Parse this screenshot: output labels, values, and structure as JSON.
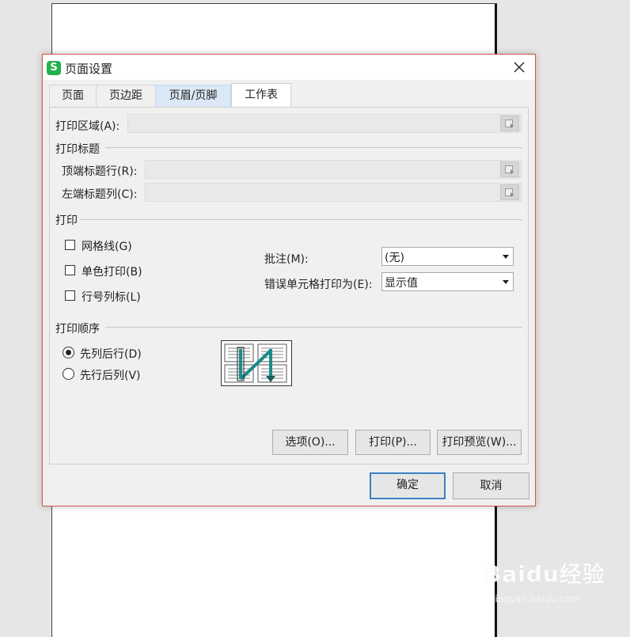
{
  "dialog": {
    "title": "页面设置",
    "app_icon_letter": "S"
  },
  "tabs": [
    {
      "label": "页面"
    },
    {
      "label": "页边距"
    },
    {
      "label": "页眉/页脚"
    },
    {
      "label": "工作表"
    }
  ],
  "print_area": {
    "label": "打印区域(A):",
    "value": ""
  },
  "print_titles": {
    "heading": "打印标题",
    "top_rows_label": "顶端标题行(R):",
    "left_cols_label": "左端标题列(C):"
  },
  "print": {
    "heading": "打印",
    "gridlines": {
      "label": "网格线(G)",
      "checked": false
    },
    "mono": {
      "label": "单色打印(B)",
      "checked": false
    },
    "row_col_headers": {
      "label": "行号列标(L)",
      "checked": false
    },
    "comments_label": "批注(M):",
    "comments_value": "(无)",
    "errors_label": "错误单元格打印为(E):",
    "errors_value": "显示值"
  },
  "print_order": {
    "heading": "打印顺序",
    "down_then_over": "先列后行(D)",
    "over_then_down": "先行后列(V)",
    "selected": "down_then_over"
  },
  "buttons": {
    "options": "选项(O)...",
    "print": "打印(P)...",
    "preview": "打印预览(W)...",
    "ok": "确定",
    "cancel": "取消"
  },
  "colors": {
    "accent": "#3c7fc6",
    "dialog_border": "#d9534f",
    "app_icon": "#21b24b",
    "order_arrow": "#1a8a8a"
  },
  "watermark": {
    "brand": "Baidu经验",
    "url": "jingyan.baidu.com"
  }
}
